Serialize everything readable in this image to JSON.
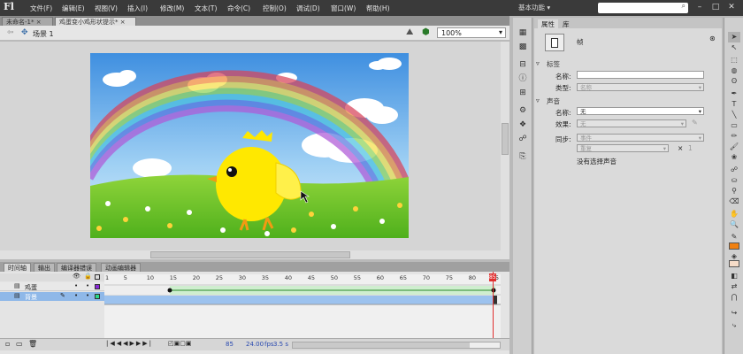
{
  "app": {
    "logo": "Fl",
    "menus": [
      "文件(F)",
      "编辑(E)",
      "视图(V)",
      "插入(I)",
      "修改(M)",
      "文本(T)",
      "命令(C)",
      "控制(O)",
      "调试(D)",
      "窗口(W)",
      "帮助(H)"
    ],
    "workspace": "基本功能",
    "window_buttons": [
      "–",
      "□",
      "✕"
    ]
  },
  "doc_tabs": [
    {
      "label": "未命名-1*",
      "active": false
    },
    {
      "label": "鸡蛋变小鸡形状提示*",
      "active": true
    }
  ],
  "scene": {
    "label": "场景 1",
    "zoom": "100%"
  },
  "timeline_tabs": [
    "时间轴",
    "输出",
    "编译器错误",
    "动画编辑器"
  ],
  "layers": [
    {
      "name": "鸡蛋",
      "selected": false
    },
    {
      "name": "背景",
      "selected": true
    }
  ],
  "ruler_numbers": [
    "1",
    "5",
    "10",
    "15",
    "20",
    "25",
    "30",
    "35",
    "40",
    "45",
    "50",
    "55",
    "60",
    "65",
    "70",
    "75",
    "80",
    "85"
  ],
  "playhead_frame": "85",
  "status": {
    "frame": "85",
    "fps": "24.00",
    "fps_unit": "fps",
    "time": "3.5 s"
  },
  "properties": {
    "tabs": [
      "属性",
      "库"
    ],
    "type_label": "帧",
    "label_section": "标签",
    "name_label": "名称:",
    "type_field_label": "类型:",
    "type_value": "名称",
    "sound_section": "声音",
    "sound_name_label": "名称:",
    "sound_name_value": "无",
    "effect_label": "效果:",
    "effect_value": "无",
    "sync_label": "同步:",
    "sync_value": "事件",
    "repeat_value": "重复",
    "repeat_count": "1",
    "no_sound": "没有选择声音"
  },
  "colors": {
    "stroke": "#f08010",
    "fill": "#f6dcc8",
    "playhead": "#e03030"
  }
}
